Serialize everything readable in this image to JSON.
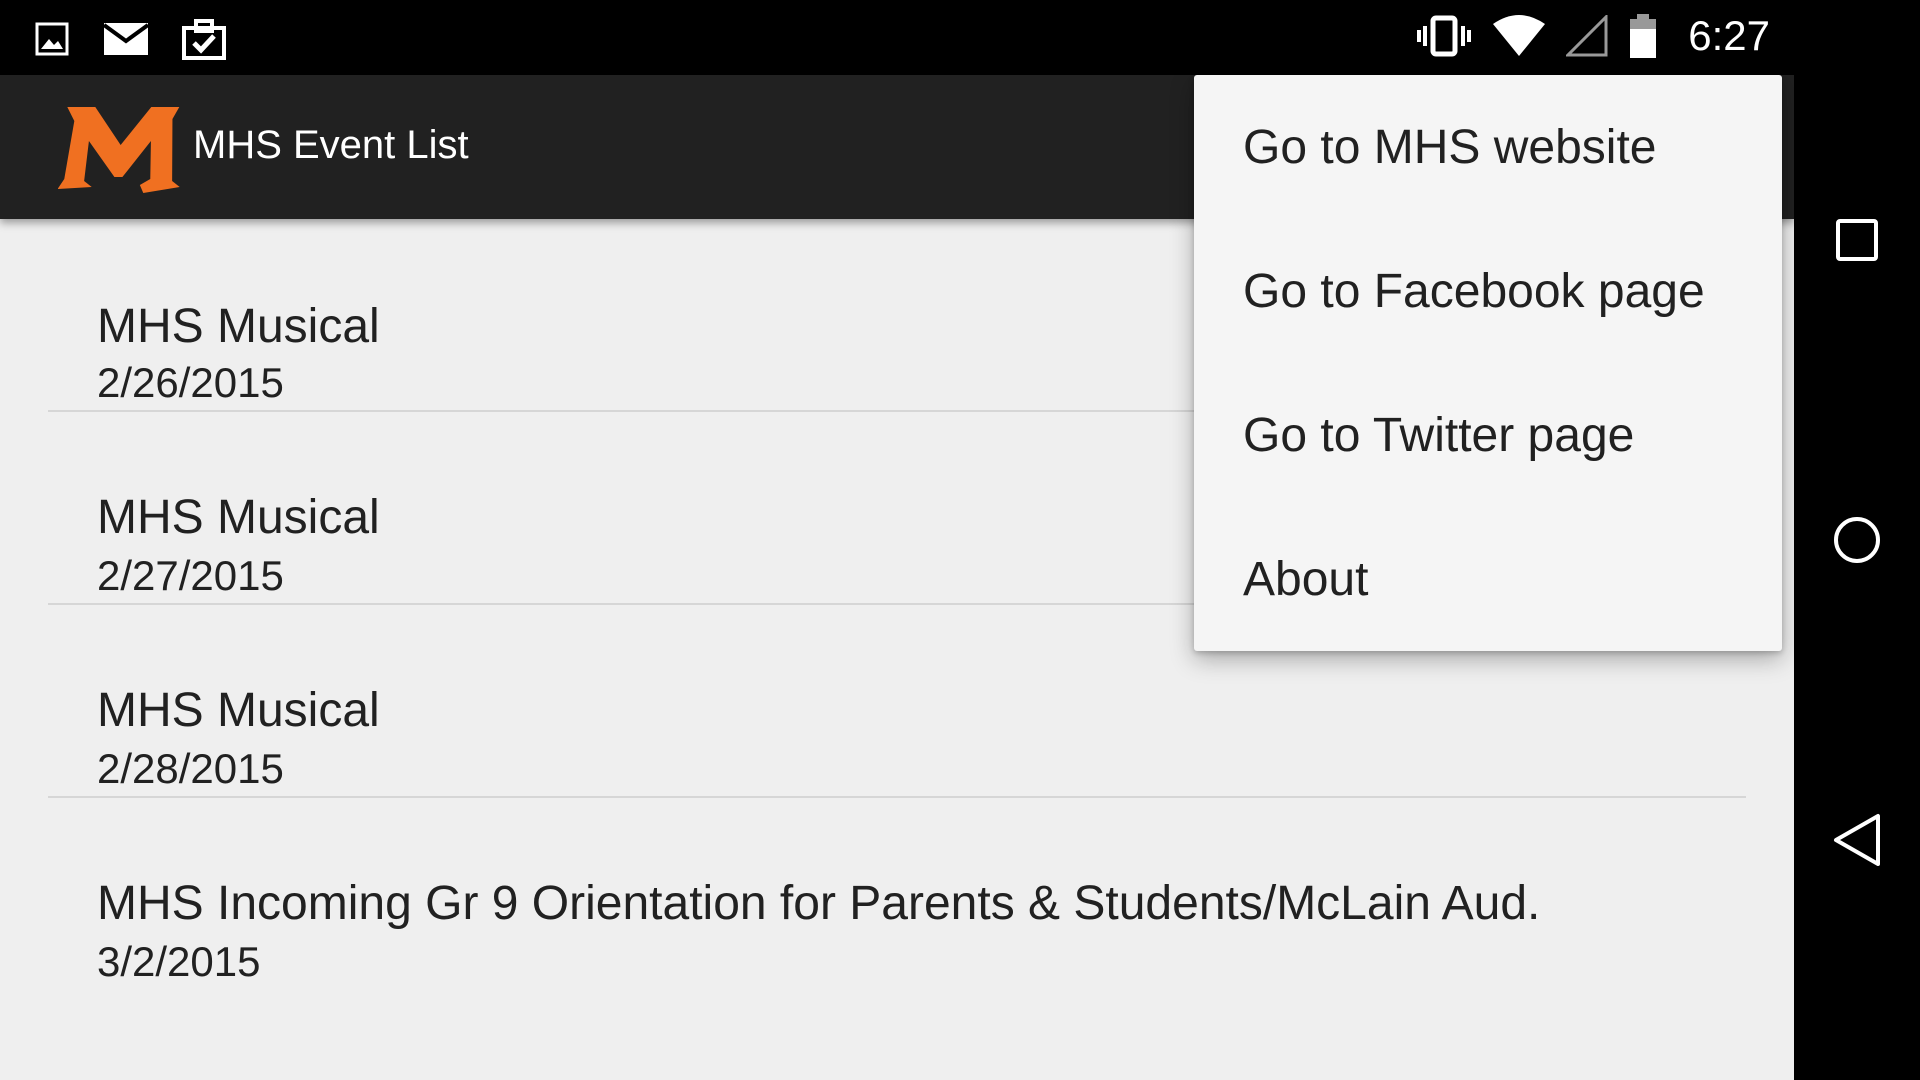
{
  "status_bar": {
    "left_icons": [
      "image-icon",
      "mail-icon",
      "clipboard-check-icon"
    ],
    "right_icons": [
      "vibrate-icon",
      "wifi-icon",
      "signal-icon",
      "battery-icon"
    ],
    "time": "6:27"
  },
  "action_bar": {
    "logo": "M",
    "title": "MHS Event List",
    "colors": {
      "background": "#212121",
      "logo": "#f07021"
    }
  },
  "events": [
    {
      "title": "MHS Musical",
      "date": "2/26/2015"
    },
    {
      "title": "MHS Musical",
      "date": "2/27/2015"
    },
    {
      "title": "MHS Musical",
      "date": "2/28/2015"
    },
    {
      "title": "MHS Incoming Gr 9 Orientation for Parents & Students/McLain Aud.",
      "date": "3/2/2015"
    }
  ],
  "overflow_menu": {
    "items": [
      {
        "label": "Go to MHS website"
      },
      {
        "label": "Go to Facebook page"
      },
      {
        "label": "Go to Twitter page"
      },
      {
        "label": "About"
      }
    ]
  },
  "nav_bar": {
    "buttons": [
      "recents-icon",
      "home-icon",
      "back-icon"
    ]
  }
}
